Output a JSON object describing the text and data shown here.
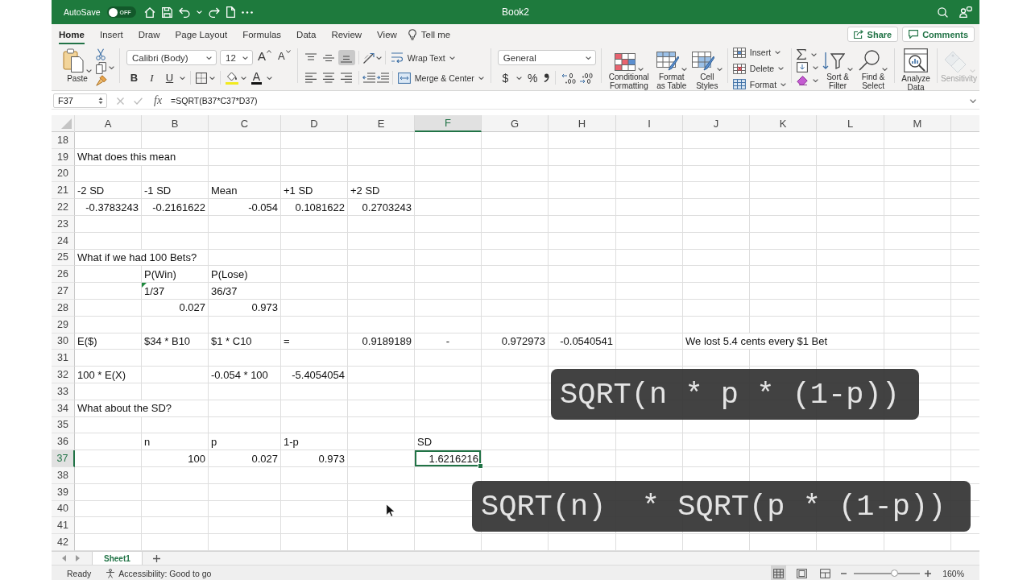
{
  "titlebar": {
    "autosave_label": "AutoSave",
    "autosave": {
      "label": "OFF",
      "on": false
    },
    "title": "Book2"
  },
  "tabs": [
    {
      "label": "Home",
      "selected": true
    },
    {
      "label": "Insert",
      "selected": false
    },
    {
      "label": "Draw",
      "selected": false
    },
    {
      "label": "Page Layout",
      "selected": false
    },
    {
      "label": "Formulas",
      "selected": false
    },
    {
      "label": "Data",
      "selected": false
    },
    {
      "label": "Review",
      "selected": false
    },
    {
      "label": "View",
      "selected": false
    }
  ],
  "tell_me": "Tell me",
  "actions": [
    {
      "kind": "share",
      "label": "Share"
    },
    {
      "kind": "comments",
      "label": "Comments"
    }
  ],
  "ribbon": {
    "paste": "Paste",
    "font": {
      "name": "Calibri (Body)",
      "size": "12",
      "size_buttons": [
        {
          "kind": "grow",
          "glyph": "A"
        },
        {
          "kind": "shrink",
          "glyph": "A"
        }
      ],
      "style_buttons": [
        {
          "kind": "bold",
          "glyph": "B"
        },
        {
          "kind": "italic",
          "glyph": "I"
        },
        {
          "kind": "underline",
          "glyph": "U"
        }
      ],
      "font_color": "A"
    },
    "vertical_align": [
      {
        "kind": "top",
        "selected": false
      },
      {
        "kind": "middle",
        "selected": false
      },
      {
        "kind": "bottom",
        "selected": true
      }
    ],
    "wrap_text": "Wrap Text",
    "merge": "Merge & Center",
    "number": {
      "format": "General",
      "buttons": [
        {
          "kind": "currency",
          "glyph": "$"
        },
        {
          "kind": "percent",
          "glyph": "%"
        }
      ]
    },
    "styles": [
      {
        "kind": "conditional",
        "label": "Conditional Formatting"
      },
      {
        "kind": "table",
        "label": "Format as Table"
      },
      {
        "kind": "cell",
        "label": "Cell Styles"
      }
    ],
    "cells": [
      {
        "kind": "insert",
        "label": "Insert"
      },
      {
        "kind": "delete",
        "label": "Delete"
      },
      {
        "kind": "format",
        "label": "Format"
      }
    ],
    "editing": [
      {
        "kind": "sort",
        "label": "Sort & Filter"
      },
      {
        "kind": "find",
        "label": "Find & Select"
      }
    ],
    "analysis": [
      {
        "kind": "analyze",
        "label": "Analyze Data",
        "disabled": false
      },
      {
        "kind": "sensitivity",
        "label": "Sensitivity",
        "disabled": true
      }
    ]
  },
  "formula_bar": {
    "name_box": "F37",
    "function_glyph": "fx",
    "formula": "=SQRT(B37*C37*D37)"
  },
  "sheet": {
    "columns": [
      {
        "label": "A",
        "selected": false
      },
      {
        "label": "B",
        "selected": false
      },
      {
        "label": "C",
        "selected": false
      },
      {
        "label": "D",
        "selected": false
      },
      {
        "label": "E",
        "selected": false
      },
      {
        "label": "F",
        "selected": true
      },
      {
        "label": "G",
        "selected": false
      },
      {
        "label": "H",
        "selected": false
      },
      {
        "label": "I",
        "selected": false
      },
      {
        "label": "J",
        "selected": false
      },
      {
        "label": "K",
        "selected": false
      },
      {
        "label": "L",
        "selected": false
      },
      {
        "label": "M",
        "selected": false
      }
    ],
    "rows": [
      {
        "number": "18",
        "selected": false
      },
      {
        "number": "19",
        "selected": false,
        "cells": {
          "A": {
            "text": "What does this mean",
            "kind": "text",
            "selected": false
          }
        }
      },
      {
        "number": "20",
        "selected": false
      },
      {
        "number": "21",
        "selected": false,
        "cells": {
          "A": {
            "text": "-2 SD",
            "kind": "text",
            "selected": false
          },
          "B": {
            "text": "-1 SD",
            "kind": "text",
            "selected": false
          },
          "C": {
            "text": "Mean",
            "kind": "text",
            "selected": false
          },
          "D": {
            "text": "+1 SD",
            "kind": "text",
            "selected": false
          },
          "E": {
            "text": "+2 SD",
            "kind": "text",
            "selected": false
          }
        }
      },
      {
        "number": "22",
        "selected": false,
        "cells": {
          "A": {
            "text": "-0.3783243",
            "kind": "number",
            "selected": false
          },
          "B": {
            "text": "-0.2161622",
            "kind": "number",
            "selected": false
          },
          "C": {
            "text": "-0.054",
            "kind": "number",
            "selected": false
          },
          "D": {
            "text": "0.1081622",
            "kind": "number",
            "selected": false
          },
          "E": {
            "text": "0.2703243",
            "kind": "number",
            "selected": false
          }
        }
      },
      {
        "number": "23",
        "selected": false
      },
      {
        "number": "24",
        "selected": false
      },
      {
        "number": "25",
        "selected": false,
        "cells": {
          "A": {
            "text": "What if we had 100 Bets?",
            "kind": "text",
            "selected": false
          }
        }
      },
      {
        "number": "26",
        "selected": false,
        "cells": {
          "B": {
            "text": "P(Win)",
            "kind": "text",
            "selected": false
          },
          "C": {
            "text": "P(Lose)",
            "kind": "text",
            "selected": false
          }
        }
      },
      {
        "number": "27",
        "selected": false,
        "cells": {
          "B": {
            "text": "1/37",
            "kind": "flagged",
            "selected": false
          },
          "C": {
            "text": "36/37",
            "kind": "text",
            "selected": false
          }
        }
      },
      {
        "number": "28",
        "selected": false,
        "cells": {
          "B": {
            "text": "0.027",
            "kind": "number",
            "selected": false
          },
          "C": {
            "text": "0.973",
            "kind": "number",
            "selected": false
          }
        }
      },
      {
        "number": "29",
        "selected": false
      },
      {
        "number": "30",
        "selected": false,
        "cells": {
          "A": {
            "text": "E($)",
            "kind": "text",
            "selected": false
          },
          "B": {
            "text": "$34 * B10",
            "kind": "text",
            "selected": false
          },
          "C": {
            "text": "$1 * C10",
            "kind": "text",
            "selected": false
          },
          "D": {
            "text": "=",
            "kind": "text",
            "selected": false
          },
          "E": {
            "text": "0.9189189",
            "kind": "number",
            "selected": false
          },
          "F": {
            "text": "-",
            "kind": "centered",
            "selected": false
          },
          "G": {
            "text": "0.972973",
            "kind": "number",
            "selected": false
          },
          "H": {
            "text": "-0.0540541",
            "kind": "number",
            "selected": false
          },
          "J": {
            "text": "We lost 5.4 cents every $1 Bet",
            "kind": "text",
            "selected": false
          }
        }
      },
      {
        "number": "31",
        "selected": false
      },
      {
        "number": "32",
        "selected": false,
        "cells": {
          "A": {
            "text": "100 * E(X)",
            "kind": "text",
            "selected": false
          },
          "C": {
            "text": "-0.054 * 100",
            "kind": "text",
            "selected": false
          },
          "D": {
            "text": "-5.4054054",
            "kind": "number",
            "selected": false
          }
        }
      },
      {
        "number": "33",
        "selected": false
      },
      {
        "number": "34",
        "selected": false,
        "cells": {
          "A": {
            "text": "What about the SD?",
            "kind": "text",
            "selected": false
          }
        }
      },
      {
        "number": "35",
        "selected": false
      },
      {
        "number": "36",
        "selected": false,
        "cells": {
          "B": {
            "text": "n",
            "kind": "text",
            "selected": false
          },
          "C": {
            "text": "p",
            "kind": "text",
            "selected": false
          },
          "D": {
            "text": "1-p",
            "kind": "text",
            "selected": false
          },
          "F": {
            "text": "SD",
            "kind": "text",
            "selected": false
          }
        }
      },
      {
        "number": "37",
        "selected": true,
        "cells": {
          "B": {
            "text": "100",
            "kind": "number",
            "selected": false
          },
          "C": {
            "text": "0.027",
            "kind": "number",
            "selected": false
          },
          "D": {
            "text": "0.973",
            "kind": "number",
            "selected": false
          },
          "F": {
            "text": "1.6216216",
            "kind": "number",
            "selected": true
          }
        }
      },
      {
        "number": "38",
        "selected": false
      },
      {
        "number": "39",
        "selected": false
      },
      {
        "number": "40",
        "selected": false
      },
      {
        "number": "41",
        "selected": false
      },
      {
        "number": "42",
        "selected": false
      }
    ]
  },
  "captions": [
    {
      "text": "SQRT(n * p * (1-p))"
    },
    {
      "text": "SQRT(n)  * SQRT(p * (1-p))"
    }
  ],
  "sheet_tabs": [
    {
      "label": "Sheet1",
      "selected": true
    }
  ],
  "status_bar": {
    "status": "Ready",
    "accessibility": "Accessibility: Good to go",
    "views": [
      {
        "kind": "normal",
        "selected": true
      },
      {
        "kind": "page-layout",
        "selected": false
      },
      {
        "kind": "page-break",
        "selected": false
      }
    ],
    "zoom": {
      "level": 0.61,
      "reading": "160%"
    }
  }
}
